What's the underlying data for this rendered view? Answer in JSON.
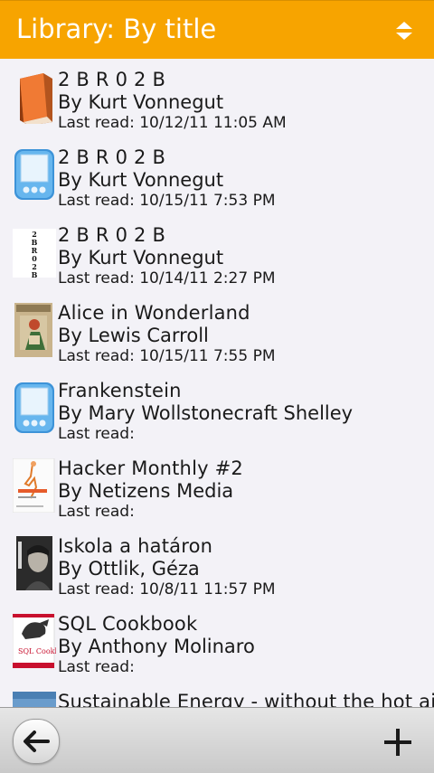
{
  "header": {
    "title": "Library: By title"
  },
  "books": [
    {
      "title": "2 B R 0 2 B",
      "author": "By Kurt Vonnegut",
      "last_read": "Last read: 10/12/11 11:05 AM",
      "cover": "book-icon"
    },
    {
      "title": "2 B R 0 2 B",
      "author": "By Kurt Vonnegut",
      "last_read": "Last read: 10/15/11 7:53 PM",
      "cover": "ereader-icon"
    },
    {
      "title": "2 B R 0 2 B",
      "author": "By Kurt Vonnegut",
      "last_read": "Last read: 10/14/11 2:27 PM",
      "cover": "text-cover"
    },
    {
      "title": "Alice in Wonderland",
      "author": "By Lewis Carroll",
      "last_read": "Last read: 10/15/11 7:55 PM",
      "cover": "illustrated-cover"
    },
    {
      "title": "Frankenstein",
      "author": "By Mary Wollstonecraft Shelley",
      "last_read": "Last read:",
      "cover": "ereader-icon"
    },
    {
      "title": "Hacker Monthly #2",
      "author": "By Netizens Media",
      "last_read": "Last read:",
      "cover": "magazine-cover"
    },
    {
      "title": "Iskola a határon",
      "author": "By Ottlik, Géza",
      "last_read": "Last read: 10/8/11 11:57 PM",
      "cover": "portrait-cover"
    },
    {
      "title": "SQL Cookbook",
      "author": "By Anthony Molinaro",
      "last_read": "Last read:",
      "cover": "oreilly-cover"
    },
    {
      "title": "Sustainable Energy - without the hot air",
      "author": "",
      "last_read": "",
      "cover": "blue-cover"
    }
  ],
  "cover_text": {
    "text_cover_letters": [
      "2",
      "B",
      "R",
      "0",
      "2",
      "B"
    ],
    "sql_title": "SQL Cookbook"
  },
  "colors": {
    "accent": "#f7a400",
    "list_bg": "#f3f2f7",
    "toolbar": "#d8d8d8"
  },
  "toolbar": {
    "back_icon": "back-arrow-icon",
    "add_icon": "plus-icon"
  }
}
